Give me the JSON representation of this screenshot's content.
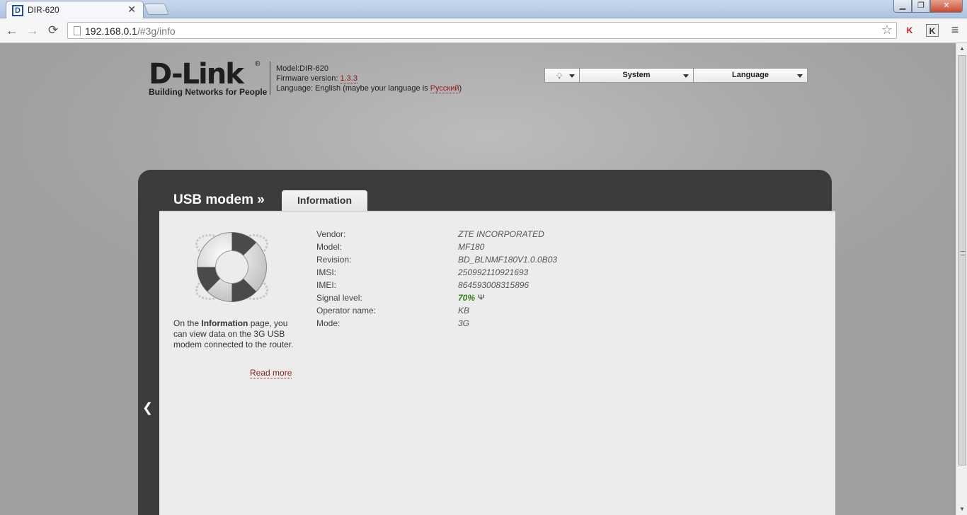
{
  "browser": {
    "tab_title": "DIR-620",
    "favicon_letter": "D",
    "url_host": "192.168.0.1",
    "url_path": "/#3g/info"
  },
  "header": {
    "logo_text": "D-Link",
    "logo_tagline": "Building Networks for People",
    "model_line": "Model:DIR-620",
    "firmware_prefix": "Firmware version: ",
    "firmware_version": "1.3.3",
    "language_prefix": "Language: English (maybe your language is ",
    "language_link": "Русский",
    "language_suffix": ")"
  },
  "topmenu": {
    "system_label": "System",
    "language_label": "Language"
  },
  "panel": {
    "section_title": "USB modem »",
    "active_tab": "Information"
  },
  "help": {
    "text_before": "On the ",
    "text_bold": "Information",
    "text_after": " page, you can view data on the 3G USB modem connected to the router.",
    "read_more": "Read more"
  },
  "modem": {
    "vendor_label": "Vendor:",
    "vendor": "ZTE INCORPORATED",
    "model_label": "Model:",
    "model": "MF180",
    "revision_label": "Revision:",
    "revision": "BD_BLNMF180V1.0.0B03",
    "imsi_label": "IMSI:",
    "imsi": "250992110921693",
    "imei_label": "IMEI:",
    "imei": "864593008315896",
    "signal_label": "Signal level:",
    "signal": "70%",
    "operator_label": "Operator name:",
    "operator": "KB",
    "mode_label": "Mode:",
    "mode": "3G"
  },
  "colors": {
    "accent_link": "#8b1a1a",
    "signal_green": "#2e7d18",
    "panel_dark": "#3c3c3c"
  }
}
